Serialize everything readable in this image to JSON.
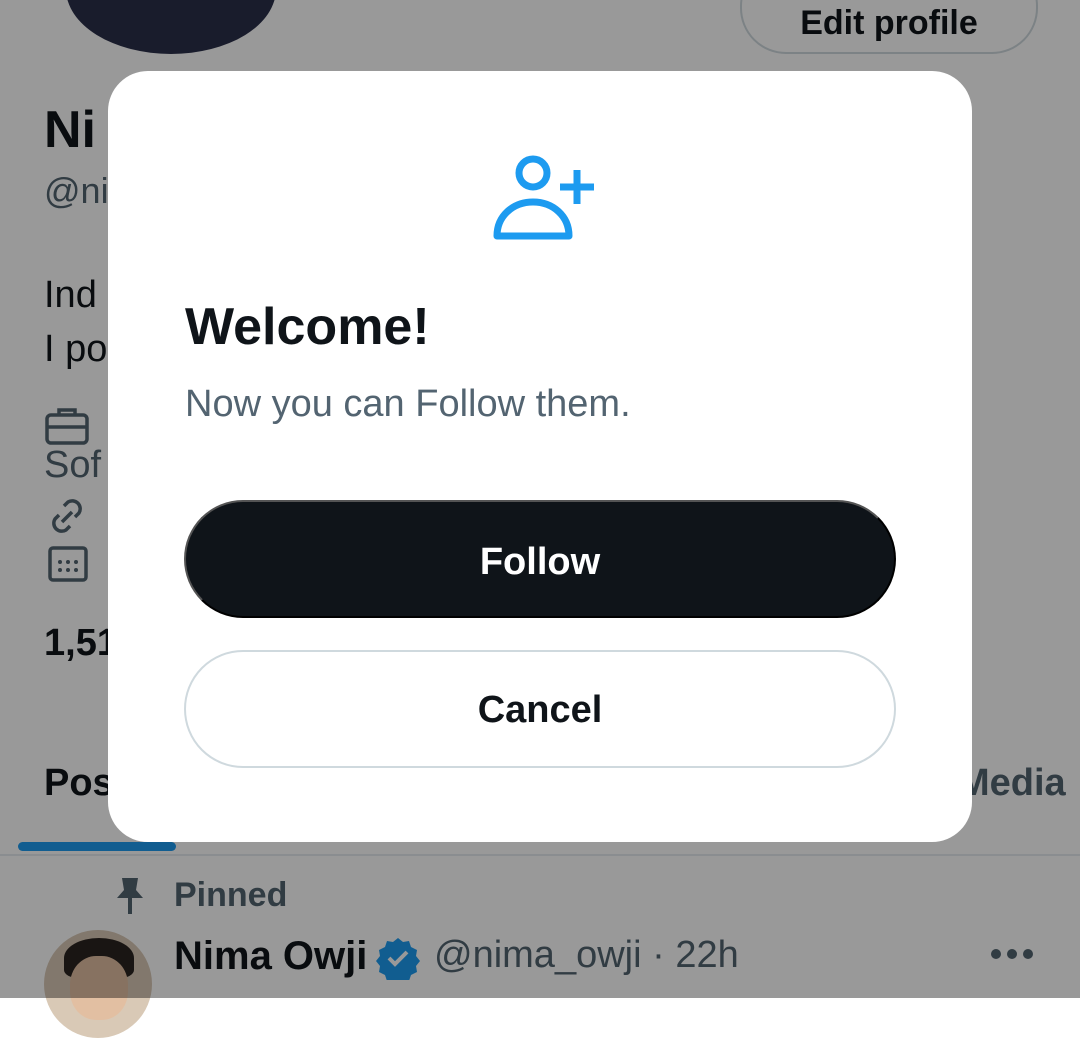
{
  "profile": {
    "edit_profile_label": "Edit profile",
    "name_partial": "Ni",
    "handle_partial": "@ni",
    "bio_line1_partial": "Ind",
    "bio_line2_partial": "I po",
    "meta_partial": "Sof",
    "counts_partial": "1,51"
  },
  "tabs": {
    "posts_partial": "Pos",
    "media_partial": "Media"
  },
  "post": {
    "pinned_label": "Pinned",
    "author_name": "Nima Owji",
    "author_handle": "@nima_owji",
    "time": "· 22h"
  },
  "modal": {
    "title": "Welcome!",
    "subtitle": "Now you can Follow them.",
    "primary_button": "Follow",
    "secondary_button": "Cancel"
  },
  "colors": {
    "accent": "#1d9bf0",
    "primary_button_bg": "#0f1419",
    "secondary_text": "#536471"
  }
}
